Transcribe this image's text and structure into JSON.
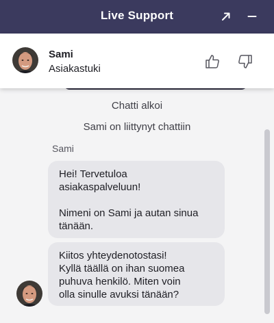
{
  "header": {
    "title": "Live Support",
    "popout_icon": "arrow-up-right-icon",
    "minimize_icon": "minus-icon"
  },
  "agent": {
    "name": "Sami",
    "role": "Asiakastuki",
    "rate_up_icon": "thumbs-up-icon",
    "rate_down_icon": "thumbs-down-icon"
  },
  "chat": {
    "system_messages": [
      "Chatti alkoi",
      "Sami on liittynyt chattiin"
    ],
    "sender_name": "Sami",
    "messages": [
      "Hei! Tervetuloa\nasiakaspalveluun!\n\nNimeni on Sami ja autan sinua\ntänään.",
      "Kiitos yhteydenotostasi!\nKyllä täällä on ihan suomea\npuhuva henkilö. Miten voin\nolla sinulle avuksi tänään?"
    ]
  },
  "colors": {
    "header_bg": "#3b3a5e",
    "chat_bg": "#f4f4f5",
    "bubble_bg": "#e6e6ea",
    "text": "#1e1e24"
  }
}
